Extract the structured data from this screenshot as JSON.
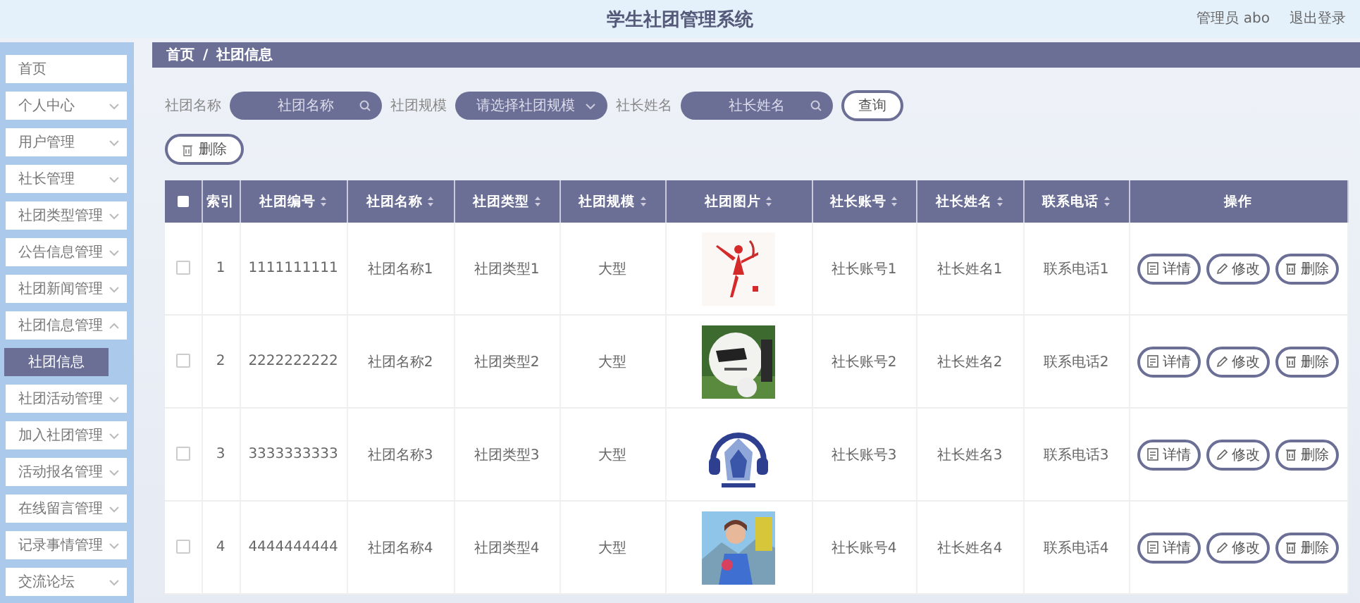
{
  "header": {
    "title": "学生社团管理系统",
    "user": "管理员 abo",
    "logout": "退出登录"
  },
  "sidebar": {
    "items": [
      {
        "label": "首页",
        "kind": "link"
      },
      {
        "label": "个人中心",
        "kind": "menu",
        "expanded": false
      },
      {
        "label": "用户管理",
        "kind": "menu",
        "expanded": false
      },
      {
        "label": "社长管理",
        "kind": "menu",
        "expanded": false
      },
      {
        "label": "社团类型管理",
        "kind": "menu",
        "expanded": false
      },
      {
        "label": "公告信息管理",
        "kind": "menu",
        "expanded": false
      },
      {
        "label": "社团新闻管理",
        "kind": "menu",
        "expanded": false
      },
      {
        "label": "社团信息管理",
        "kind": "menu",
        "expanded": true,
        "children": [
          {
            "label": "社团信息",
            "selected": true
          }
        ]
      },
      {
        "label": "社团活动管理",
        "kind": "menu",
        "expanded": false
      },
      {
        "label": "加入社团管理",
        "kind": "menu",
        "expanded": false
      },
      {
        "label": "活动报名管理",
        "kind": "menu",
        "expanded": false
      },
      {
        "label": "在线留言管理",
        "kind": "menu",
        "expanded": false
      },
      {
        "label": "记录事情管理",
        "kind": "menu",
        "expanded": false
      },
      {
        "label": "交流论坛",
        "kind": "menu",
        "expanded": false
      }
    ]
  },
  "breadcrumb": [
    "首页",
    "/",
    "社团信息"
  ],
  "filters": [
    {
      "label": "社团名称",
      "kind": "search",
      "placeholder": "社团名称"
    },
    {
      "label": "社团规模",
      "kind": "select",
      "placeholder": "请选择社团规模"
    },
    {
      "label": "社长姓名",
      "kind": "search",
      "placeholder": "社长姓名"
    }
  ],
  "query_button": "查询",
  "delete_button": "删除",
  "table": {
    "select_all_checked": false,
    "columns": [
      {
        "label": "索引",
        "sortable": false
      },
      {
        "label": "社团编号",
        "sortable": true
      },
      {
        "label": "社团名称",
        "sortable": true
      },
      {
        "label": "社团类型",
        "sortable": true
      },
      {
        "label": "社团规模",
        "sortable": true
      },
      {
        "label": "社团图片",
        "sortable": true
      },
      {
        "label": "社长账号",
        "sortable": true
      },
      {
        "label": "社长姓名",
        "sortable": true
      },
      {
        "label": "联系电话",
        "sortable": true
      },
      {
        "label": "操作",
        "sortable": false
      }
    ],
    "rows": [
      {
        "checked": false,
        "cells": [
          "1",
          "1111111111",
          "社团名称1",
          "社团类型1",
          "大型"
        ],
        "picture": {
          "kind": "picture"
        },
        "cells_after": [
          "社长账号1",
          "社长姓名1",
          "联系电话1"
        ],
        "actions": [
          {
            "label": "详情",
            "kind": "detail"
          },
          {
            "label": "修改",
            "kind": "edit"
          },
          {
            "label": "删除",
            "kind": "delete"
          }
        ]
      },
      {
        "checked": false,
        "cells": [
          "2",
          "2222222222",
          "社团名称2",
          "社团类型2",
          "大型"
        ],
        "picture": {
          "kind": "picture"
        },
        "cells_after": [
          "社长账号2",
          "社长姓名2",
          "联系电话2"
        ],
        "actions": [
          {
            "label": "详情",
            "kind": "detail"
          },
          {
            "label": "修改",
            "kind": "edit"
          },
          {
            "label": "删除",
            "kind": "delete"
          }
        ]
      },
      {
        "checked": false,
        "cells": [
          "3",
          "3333333333",
          "社团名称3",
          "社团类型3",
          "大型"
        ],
        "picture": {
          "kind": "picture"
        },
        "cells_after": [
          "社长账号3",
          "社长姓名3",
          "联系电话3"
        ],
        "actions": [
          {
            "label": "详情",
            "kind": "detail"
          },
          {
            "label": "修改",
            "kind": "edit"
          },
          {
            "label": "删除",
            "kind": "delete"
          }
        ]
      },
      {
        "checked": false,
        "cells": [
          "4",
          "4444444444",
          "社团名称4",
          "社团类型4",
          "大型"
        ],
        "picture": {
          "kind": "picture"
        },
        "cells_after": [
          "社长账号4",
          "社长姓名4",
          "联系电话4"
        ],
        "actions": [
          {
            "label": "详情",
            "kind": "detail"
          },
          {
            "label": "修改",
            "kind": "edit"
          },
          {
            "label": "删除",
            "kind": "delete"
          }
        ]
      }
    ]
  }
}
